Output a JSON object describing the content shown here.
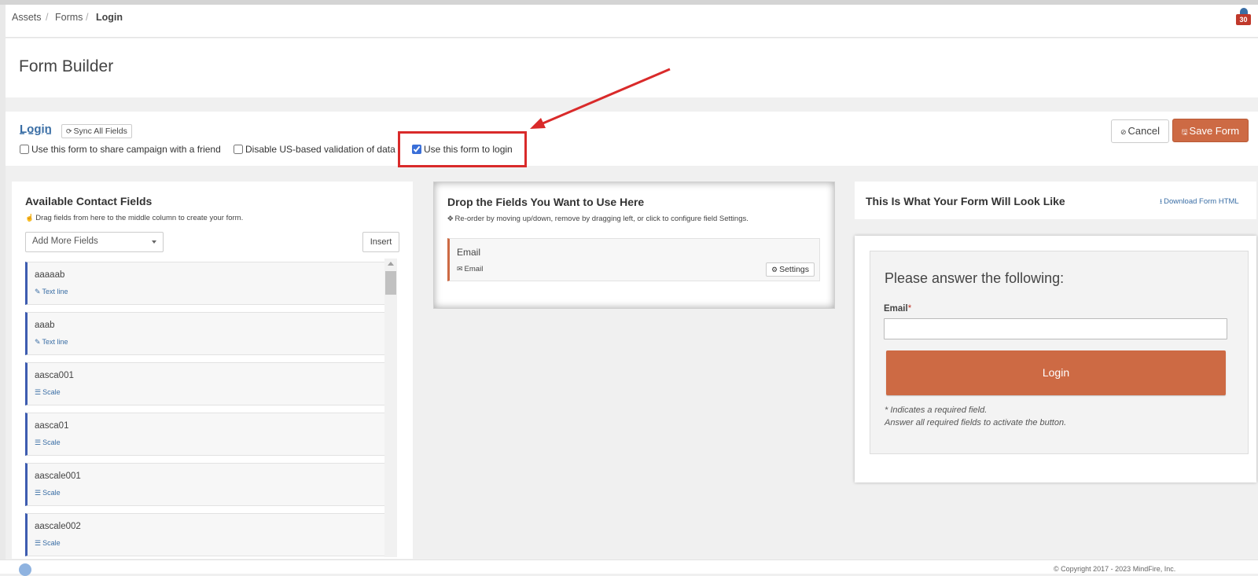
{
  "breadcrumb": [
    "Assets",
    "Forms",
    "Login"
  ],
  "notifications": {
    "count": "30"
  },
  "page_title": "Form Builder",
  "form": {
    "name": "Login",
    "sync_label": "Sync All Fields",
    "options": [
      {
        "label": "Use this form to share campaign with a friend",
        "checked": false
      },
      {
        "label": "Disable US-based validation of data",
        "checked": false
      },
      {
        "label": "Use this form to login",
        "checked": true
      }
    ],
    "cancel_label": "Cancel",
    "save_label": "Save Form"
  },
  "left_panel": {
    "title": "Available Contact Fields",
    "hint": "Drag fields from here to the middle column to create your form.",
    "dropdown_placeholder": "Add More Fields",
    "insert_label": "Insert",
    "fields": [
      {
        "name": "aaaaab",
        "type": "Text line",
        "icon": "edit-icon"
      },
      {
        "name": "aaab",
        "type": "Text line",
        "icon": "edit-icon"
      },
      {
        "name": "aasca001",
        "type": "Scale",
        "icon": "sliders-icon"
      },
      {
        "name": "aasca01",
        "type": "Scale",
        "icon": "sliders-icon"
      },
      {
        "name": "aascale001",
        "type": "Scale",
        "icon": "sliders-icon"
      },
      {
        "name": "aascale002",
        "type": "Scale",
        "icon": "sliders-icon"
      }
    ]
  },
  "middle_panel": {
    "title": "Drop the Fields You Want to Use Here",
    "hint": "Re-order by moving up/down, remove by dragging left, or click to configure field Settings.",
    "field": {
      "name": "Email",
      "type": "Email",
      "settings_label": "Settings"
    }
  },
  "right_panel": {
    "title": "This Is What Your Form Will Look Like",
    "download_label": "Download Form HTML",
    "preview": {
      "heading": "Please answer the following:",
      "email_label": "Email",
      "required_mark": "*",
      "button_label": "Login",
      "note_1": "* Indicates a required field.",
      "note_2": "Answer all required fields to activate the button."
    }
  },
  "footer": {
    "copyright": "© Copyright 2017 - 2023 MindFire, Inc."
  },
  "colors": {
    "accent": "#cd6a44",
    "link": "#3a6ea5",
    "highlight": "#d92a2a",
    "field_border": "#3d5cb0"
  }
}
